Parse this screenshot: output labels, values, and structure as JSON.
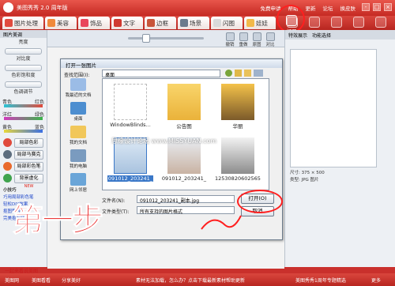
{
  "app": {
    "title": "美图秀秀 2.0 周年版",
    "top_links": [
      "免费申请",
      "帮助",
      "更新",
      "论坛",
      "换皮肤"
    ]
  },
  "tabs": [
    "图片处理",
    "美容",
    "饰品",
    "文字",
    "边框",
    "场景",
    "闪图",
    "娃娃"
  ],
  "right_tools": [
    "打开",
    "新建",
    "保存",
    "尺寸",
    "旋转",
    "涂鸦"
  ],
  "toolbar2": [
    "撤销",
    "重做",
    "原图",
    "对比",
    "预览",
    "打印"
  ],
  "left_panel": {
    "header": "图片美调",
    "sliders": [
      "亮度",
      "对比度",
      "色彩饱和度",
      "色调调节"
    ],
    "color_pairs": [
      [
        "青色",
        "红色"
      ],
      [
        "洋红",
        "绿色"
      ],
      [
        "黄色",
        "蓝色"
      ]
    ],
    "buttons": [
      "局部色彩",
      "局部马赛克",
      "局部彩色笔",
      "背景虚化"
    ],
    "new_badge": "NEW",
    "tips_header": "小技巧",
    "tips": [
      "巧用局部彩色笔",
      "轻松DIY效果",
      "抠图教程",
      "完美抠图精品"
    ],
    "bottom_link": "一起来看说美图"
  },
  "dialog": {
    "title": "打开一张图片",
    "lookin_label": "查找范围(I):",
    "lookin_value": "桌面",
    "places": [
      "我最近的文档",
      "桌面",
      "我的文档",
      "我的电脑",
      "网上邻居"
    ],
    "files": [
      "WindowBlinds...",
      "公告图",
      "华丽",
      "091012_203241_",
      "091012_203241_",
      "12530820602565..."
    ],
    "filename_label": "文件名(N):",
    "filename_value": "091012_203241_副本.jpg",
    "filetype_label": "文件类型(T):",
    "filetype_value": "所有支持的图片格式",
    "open_button": "打开(O)",
    "cancel_button": "取消"
  },
  "right_panel": {
    "tabs": [
      "特效展示",
      "功能选择"
    ],
    "info": [
      "尺寸: 375 × 500",
      "类型: JPG 图片"
    ]
  },
  "watermark": "思缘设计论坛 www.MISSYUAN.com",
  "annotation": "第一步",
  "status": {
    "left": [
      "美图网",
      "美图看看",
      "分享美好"
    ],
    "center": "素材无法加载，怎么办？点击下载最新素材帮助更新",
    "right": "美图秀秀1周年专题精选",
    "right2": "更多"
  }
}
